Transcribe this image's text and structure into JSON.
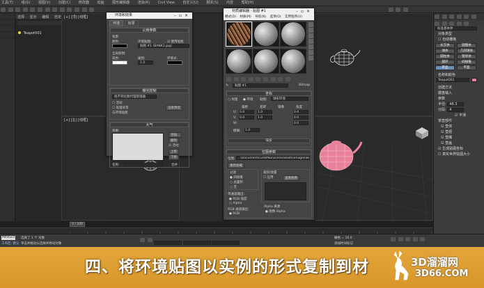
{
  "menubar": {
    "items": [
      "工具(T)",
      "组(G)",
      "视图(V)",
      "创建(C)",
      "修改器",
      "动画",
      "图形编辑器",
      "渲染(R)",
      "Civil View",
      "自定义(U)",
      "脚本(S)",
      "内容",
      "帮助(H)"
    ]
  },
  "scene_explorer": {
    "tabs": [
      "选择",
      "显示",
      "编辑",
      "自定义"
    ],
    "item": "Teapot001"
  },
  "env_dialog": {
    "title": "环境和效果",
    "tabs": [
      "环境",
      "效果"
    ],
    "common_params_header": "公用参数",
    "background_label": "背景:",
    "color_label": "颜色:",
    "env_map_label": "环境贴图:",
    "use_map_label": "使用贴图",
    "map_name": "贴图 #1 (BANK3.jpg)",
    "global_lighting_label": "全局照明:",
    "tint_label": "染色:",
    "level_label": "级别:",
    "level_value": "1.0",
    "ambient_label": "环境光:",
    "exposure_header": "曝光控制",
    "exposure_select": "找不到位图代理管理器",
    "active_label": "活动",
    "process_bg_label": "处理背景",
    "env_map_2_label": "与环境贴图",
    "render_preview_label": "渲染预览",
    "atmosphere_header": "大气",
    "effects_label": "效果:",
    "add_label": "添加...",
    "delete_label": "删除",
    "active2_label": "活动",
    "up_label": "上移",
    "down_label": "下移",
    "merge_label": "合并",
    "name_label": "名称:"
  },
  "mat_editor": {
    "title": "材质编辑器 - 贴图 #1",
    "menu": [
      "模式(D)",
      "材质(M)",
      "导航(N)",
      "选项(O)",
      "实用程序(U)"
    ],
    "map_name": "贴图 #1",
    "map_type": "Bitmap",
    "coords_header": "坐标",
    "texture_label": "纹理",
    "env_label": "环境",
    "mapping_label": "贴图:",
    "mapping_value": "球形环境",
    "offset_label": "偏移",
    "tiling_label": "瓷砖",
    "mirror_label": "镜像",
    "angle_label": "角度",
    "u_label": "U:",
    "v_label": "V:",
    "w_label": "W:",
    "zero": "0.0",
    "one": "1.0",
    "blur_label": "模糊:",
    "blur_value": "1.0",
    "noise_header": "噪波",
    "bitmap_params_header": "位图参数",
    "bitmap_label": "位图:",
    "bitmap_path": "...\\Documents\\3dsMax\\sceneassets\\images\\BANK3.jpg",
    "reload_label": "重新加载",
    "filter_label": "过滤",
    "pyramid_label": "四棱锥",
    "summed_label": "总面积",
    "none_label": "无",
    "crop_label": "裁剪/放置",
    "apply_label": "应用",
    "view_image_label": "查看图像",
    "mono_output_label": "单通道输出:",
    "rgb_intensity_label": "RGB 强度",
    "alpha_label": "Alpha",
    "rgb_output_label": "RGB 通道输出:",
    "rgb_label": "RGB",
    "alpha_source_label": "Alpha 来源",
    "image_alpha_label": "图像 Alpha",
    "premult_label": "预乘 Alpha"
  },
  "viewports": {
    "top_left": "[+] [顶] [线框]",
    "bottom_left": "[+] [左] [线框]",
    "top_right": "[+] [透视]",
    "perspective": "[+] [透视] [真实]"
  },
  "command_panel": {
    "object_type_header": "对象类型",
    "autogrid": "自动栅格",
    "buttons": [
      "长方体",
      "圆锥体",
      "球体",
      "几何球体",
      "圆柱体",
      "管状体",
      "圆环",
      "四棱锥",
      "茶壶",
      "平面"
    ],
    "standard_primitives": "标准基本体",
    "name_color_header": "名称和颜色",
    "name_value": "Teapot001",
    "creation_method_header": "创建方法",
    "keyboard_entry_header": "键盘输入",
    "params_header": "参数",
    "radius_label": "半径:",
    "radius_value": "48.3",
    "segments_label": "分段:",
    "segments_value": "4",
    "smooth_label": "平滑",
    "parts_label": "茶壶部件",
    "parts": [
      "壶体",
      "壶把",
      "壶嘴",
      "壶盖"
    ],
    "gen_map_label": "生成贴图坐标",
    "real_world_label": "真实世界贴图大小"
  },
  "timeline": {
    "frame": "0 / 100"
  },
  "status": {
    "selection": "选择了 1 个 对象",
    "hint": "单击并拖动以选择并移动对象",
    "workspace_label": "工作区: 默认",
    "grid_label": "栅格 = 10.0",
    "add_time_tag": "添加时间标记",
    "left_menu": "MAXScript"
  },
  "caption": {
    "text": "四、将环境贴图以实例的形式复制到材"
  },
  "watermark": {
    "main": "3D溜溜网",
    "sub": "3D66.COM"
  },
  "colors": {
    "caption_bg": "#e3a63a",
    "teapot_pink": "#e8829a",
    "viewport_bg": "#2a2a2a"
  }
}
